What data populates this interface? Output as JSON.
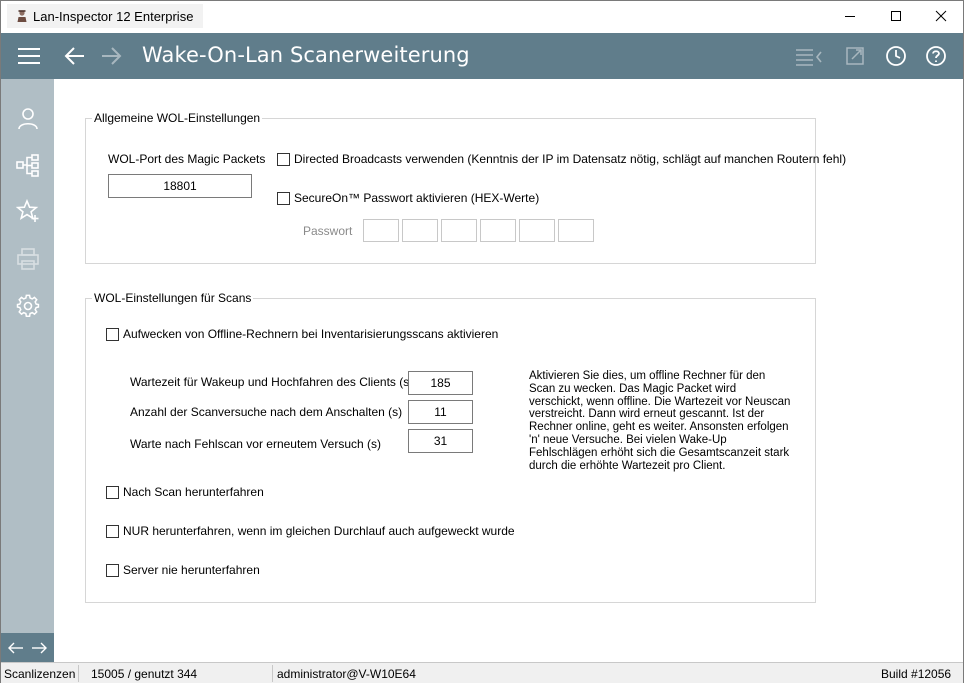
{
  "window": {
    "title": "Lan-Inspector 12 Enterprise",
    "minimize_icon": "minimize-icon",
    "maximize_icon": "maximize-icon",
    "close_icon": "close-icon"
  },
  "header": {
    "title": "Wake-On-Lan Scanerweiterung",
    "background": "#607d8b",
    "icons": [
      "menu-icon",
      "back-arrow-icon",
      "forward-arrow-icon",
      "list-export-icon",
      "open-external-icon",
      "clock-icon",
      "help-icon"
    ]
  },
  "sidebar": {
    "background": "#b0bec5",
    "items": [
      "user-icon",
      "network-tree-icon",
      "star-add-icon",
      "printer-icon",
      "settings-gear-icon"
    ],
    "footer_icons": [
      "left-arrow-icon",
      "right-arrow-icon"
    ]
  },
  "general": {
    "legend": "Allgemeine WOL-Einstellungen",
    "port_label": "WOL-Port des Magic Packets",
    "port_value": "18801",
    "directed_broadcast_label": "Directed Broadcasts verwenden (Kenntnis der IP im Datensatz nötig, schlägt auf manchen Routern fehl)",
    "directed_broadcast_checked": false,
    "secureon_label": "SecureOn™ Passwort aktivieren (HEX-Werte)",
    "secureon_checked": false,
    "password_label": "Passwort",
    "password_fields": [
      "",
      "",
      "",
      "",
      "",
      ""
    ]
  },
  "scans": {
    "legend": "WOL-Einstellungen für Scans",
    "wake_offline_label": "Aufwecken von Offline-Rechnern bei Inventarisierungsscans aktivieren",
    "wake_offline_checked": false,
    "wait_label": "Wartezeit für Wakeup und Hochfahren des Clients (s)",
    "wait_value": "185",
    "attempts_label": "Anzahl der Scanversuche nach dem Anschalten (s)",
    "attempts_value": "11",
    "retry_label": "Warte nach Fehlscan vor erneutem Versuch (s)",
    "retry_value": "31",
    "help_text": "Aktivieren Sie dies, um offline Rechner für den Scan zu wecken. Das Magic Packet wird verschickt, wenn offline. Die Wartezeit vor Neuscan verstreicht. Dann wird erneut gescannt. Ist der Rechner online, geht es weiter. Ansonsten erfolgen 'n' neue Versuche. Bei vielen Wake-Up Fehlschlägen erhöht sich die Gesamtscanzeit stark durch die erhöhte Wartezeit pro Client.",
    "shutdown_label": "Nach Scan herunterfahren",
    "shutdown_checked": false,
    "shutdown_only_label": "NUR herunterfahren, wenn im gleichen Durchlauf auch aufgeweckt wurde",
    "shutdown_only_checked": false,
    "server_never_label": "Server nie herunterfahren",
    "server_never_checked": false
  },
  "status": {
    "licenses_label": "Scanlizenzen",
    "licenses_value": "15005 / genutzt 344",
    "user": "administrator@V-W10E64",
    "build": "Build #12056"
  }
}
